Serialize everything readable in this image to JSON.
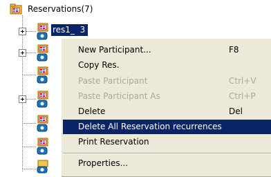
{
  "tree": {
    "root_label": "Reservations(7)",
    "selected_node_label": "res1_  3"
  },
  "context_menu": {
    "items": [
      {
        "label": "New Participant...",
        "shortcut": "F8",
        "disabled": false,
        "highlighted": false
      },
      {
        "label": "Copy Res.",
        "shortcut": "",
        "disabled": false,
        "highlighted": false
      },
      {
        "label": "Paste Participant",
        "shortcut": "Ctrl+V",
        "disabled": true,
        "highlighted": false
      },
      {
        "label": "Paste Participant As",
        "shortcut": "Ctrl+P",
        "disabled": true,
        "highlighted": false
      },
      {
        "label": "Delete",
        "shortcut": "Del",
        "disabled": false,
        "highlighted": false
      },
      {
        "label": "Delete All Reservation recurrences",
        "shortcut": "",
        "disabled": false,
        "highlighted": true
      },
      {
        "label": "Print Reservation",
        "shortcut": "",
        "disabled": false,
        "highlighted": false
      },
      {
        "label": "Properties...",
        "shortcut": "",
        "disabled": false,
        "highlighted": false
      }
    ]
  },
  "colors": {
    "selection": "#0a246a",
    "menu_background": "#ece9d8",
    "disabled_text": "#aca899"
  },
  "icons": [
    "reservation-folder-icon",
    "phone-icon",
    "expand-plus-icon"
  ]
}
